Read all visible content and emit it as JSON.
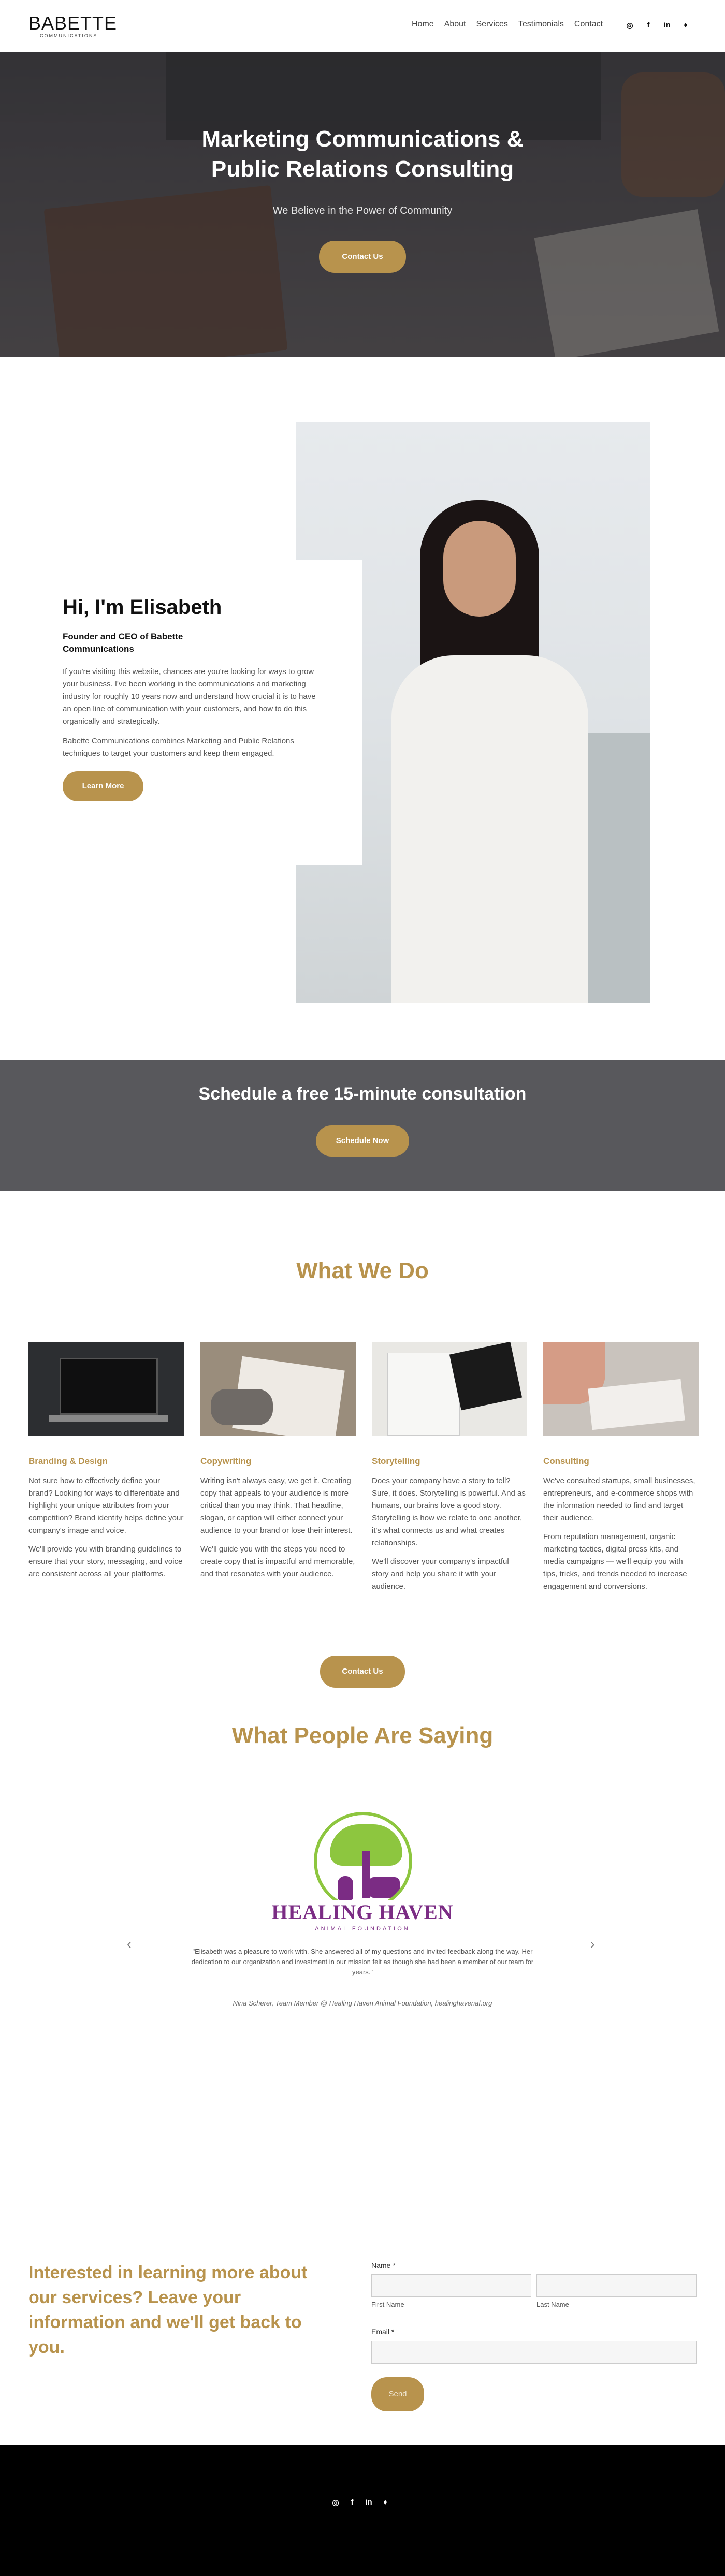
{
  "header": {
    "logo_main": "BABETTE",
    "logo_sub": "COMMUNICATIONS",
    "nav": [
      "Home",
      "About",
      "Services",
      "Testimonials",
      "Contact"
    ],
    "social_icons": [
      "instagram-icon",
      "facebook-icon",
      "linkedin-icon",
      "twitter-icon"
    ]
  },
  "hero": {
    "title_line1": "Marketing Communications &",
    "title_line2": "Public Relations Consulting",
    "subtitle": "We Believe in the Power of Community",
    "button": "Contact Us"
  },
  "about": {
    "title": "Hi, I'm Elisabeth",
    "role": "Founder and CEO of Babette Communications",
    "p1": "If you're visiting this website, chances are you're looking for ways to grow your business. I've been working in the communications and marketing industry for roughly 10 years now and understand how crucial it is to have an open line of communication with your customers, and how to do this organically and strategically.",
    "p2": "Babette Communications combines Marketing and Public Relations techniques to target your customers and keep them engaged.",
    "button": "Learn More"
  },
  "consultation": {
    "title": "Schedule a free 15-minute consultation",
    "button": "Schedule Now"
  },
  "services": {
    "title": "What We Do",
    "items": [
      {
        "title": "Branding & Design",
        "p1": "Not sure how to effectively define your brand? Looking for ways to differentiate and highlight your unique attributes from your competition? Brand identity helps define your company's image and voice.",
        "p2": "We'll provide you with branding guidelines to ensure that your story, messaging, and voice are consistent across all your platforms."
      },
      {
        "title": "Copywriting",
        "p1": "Writing isn't always easy, we get it. Creating copy that appeals to your audience is more critical than you may think. That headline, slogan, or caption will either connect your audience to your brand or lose their interest.",
        "p2": "We'll guide you with the steps you need to create copy that is impactful and memorable, and that resonates with your audience."
      },
      {
        "title": "Storytelling",
        "p1": "Does your company have a story to tell? Sure, it does. Storytelling is powerful. And as humans, our brains love a good story. Storytelling is how we relate to one another, it's what connects us and what creates relationships.",
        "p2": " We'll discover your company's impactful story and help you share it with your audience."
      },
      {
        "title": "Consulting",
        "p1": "We've consulted startups, small businesses, entrepreneurs, and e-commerce shops with the information needed to find and target their audience.",
        "p2": "From reputation management, organic marketing tactics, digital press kits, and media campaigns — we'll equip you with tips, tricks, and trends needed to increase engagement and conversions."
      }
    ],
    "button": "Contact Us"
  },
  "testimonials": {
    "title": "What People Are Saying",
    "logo_name": "HEALING HAVEN",
    "logo_tag": "ANIMAL FOUNDATION",
    "quote": "\"Elisabeth was a pleasure to work with. She answered all of my questions and invited feedback along the way. Her dedication to our organization and investment in our mission felt as though she had been a member of our team for years.\"",
    "author": "Nina Scherer, Team Member @ Healing Haven Animal Foundation, healinghavenaf.org",
    "prev": "‹",
    "next": "›"
  },
  "contact": {
    "heading": "Interested in learning more about our services? Leave your information and we'll get back to you.",
    "name_label": "Name *",
    "first_name": "First Name",
    "last_name": "Last Name",
    "email_label": "Email *",
    "send": "Send"
  },
  "colors": {
    "gold": "#b8934d",
    "band": "#58585c",
    "footer": "#000000"
  }
}
